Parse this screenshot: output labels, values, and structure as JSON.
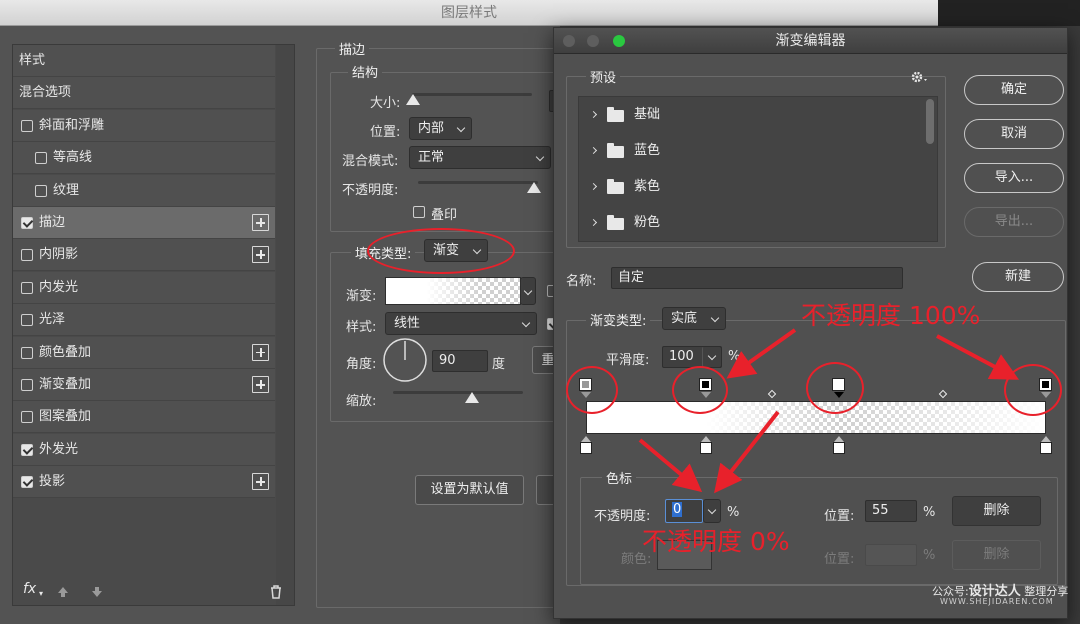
{
  "layer_style": {
    "title": "图层样式",
    "sidebar_items": [
      {
        "label": "样式",
        "checkbox": false,
        "checked": false,
        "plus": false,
        "indent": false,
        "active": false
      },
      {
        "label": "混合选项",
        "checkbox": false,
        "checked": false,
        "plus": false,
        "indent": false,
        "active": false
      },
      {
        "label": "斜面和浮雕",
        "checkbox": true,
        "checked": false,
        "plus": false,
        "indent": false,
        "active": false
      },
      {
        "label": "等高线",
        "checkbox": true,
        "checked": false,
        "plus": false,
        "indent": true,
        "active": false
      },
      {
        "label": "纹理",
        "checkbox": true,
        "checked": false,
        "plus": false,
        "indent": true,
        "active": false
      },
      {
        "label": "描边",
        "checkbox": true,
        "checked": true,
        "plus": true,
        "indent": false,
        "active": true
      },
      {
        "label": "内阴影",
        "checkbox": true,
        "checked": false,
        "plus": true,
        "indent": false,
        "active": false
      },
      {
        "label": "内发光",
        "checkbox": true,
        "checked": false,
        "plus": false,
        "indent": false,
        "active": false
      },
      {
        "label": "光泽",
        "checkbox": true,
        "checked": false,
        "plus": false,
        "indent": false,
        "active": false
      },
      {
        "label": "颜色叠加",
        "checkbox": true,
        "checked": false,
        "plus": true,
        "indent": false,
        "active": false
      },
      {
        "label": "渐变叠加",
        "checkbox": true,
        "checked": false,
        "plus": true,
        "indent": false,
        "active": false
      },
      {
        "label": "图案叠加",
        "checkbox": true,
        "checked": false,
        "plus": false,
        "indent": false,
        "active": false
      },
      {
        "label": "外发光",
        "checkbox": true,
        "checked": true,
        "plus": false,
        "indent": false,
        "active": false
      },
      {
        "label": "投影",
        "checkbox": true,
        "checked": true,
        "plus": true,
        "indent": false,
        "active": false
      }
    ],
    "footer_fx": "fx",
    "stroke": {
      "group_title": "描边",
      "structure_title": "结构",
      "size_label": "大小:",
      "position_label": "位置:",
      "position_value": "内部",
      "blend_label": "混合模式:",
      "blend_value": "正常",
      "opacity_label": "不透明度:",
      "overprint_label": "叠印",
      "fill_type_label": "填充类型:",
      "fill_type_value": "渐变",
      "gradient_label": "渐变:",
      "style_label": "样式:",
      "style_value": "线性",
      "angle_label": "角度:",
      "angle_value": "90",
      "angle_unit": "度",
      "scale_label": "缩放:",
      "default_btn": "设置为默认值"
    }
  },
  "gradient_editor": {
    "title": "渐变编辑器",
    "presets_label": "预设",
    "preset_folders": [
      "基础",
      "蓝色",
      "紫色",
      "粉色"
    ],
    "ok_btn": "确定",
    "cancel_btn": "取消",
    "import_btn": "导入...",
    "export_btn": "导出...",
    "name_label": "名称:",
    "name_value": "自定",
    "new_btn": "新建",
    "gradient_type_label": "渐变类型:",
    "gradient_type_value": "实底",
    "smoothness_label": "平滑度:",
    "smoothness_value": "100",
    "smoothness_unit": "%",
    "color_stops_title": "色标",
    "stop_opacity_label": "不透明度:",
    "stop_opacity_value": "0",
    "stop_opacity_unit": "%",
    "stop_location_label": "位置:",
    "stop_location_value": "55",
    "stop_location_unit": "%",
    "delete_btn": "删除",
    "color_label": "颜色:",
    "color_location_label": "位置:",
    "color_location_unit": "%",
    "color_delete_btn": "删除",
    "opacity_stops": [
      {
        "location": 0,
        "opacity": 100,
        "selected": false
      },
      {
        "location": 26,
        "opacity": 100,
        "selected": false
      },
      {
        "location": 55,
        "opacity": 0,
        "selected": true
      },
      {
        "location": 100,
        "opacity": 100,
        "selected": false
      }
    ]
  },
  "annotations": {
    "top_note": "不透明度 100%",
    "bottom_note": "不透明度 0%",
    "color": "#e8212b"
  },
  "watermark": {
    "prefix": "公众号:",
    "brand": "设计达人",
    "suffix": "整理分享",
    "url": "WWW.SHEJIDAREN.COM"
  }
}
